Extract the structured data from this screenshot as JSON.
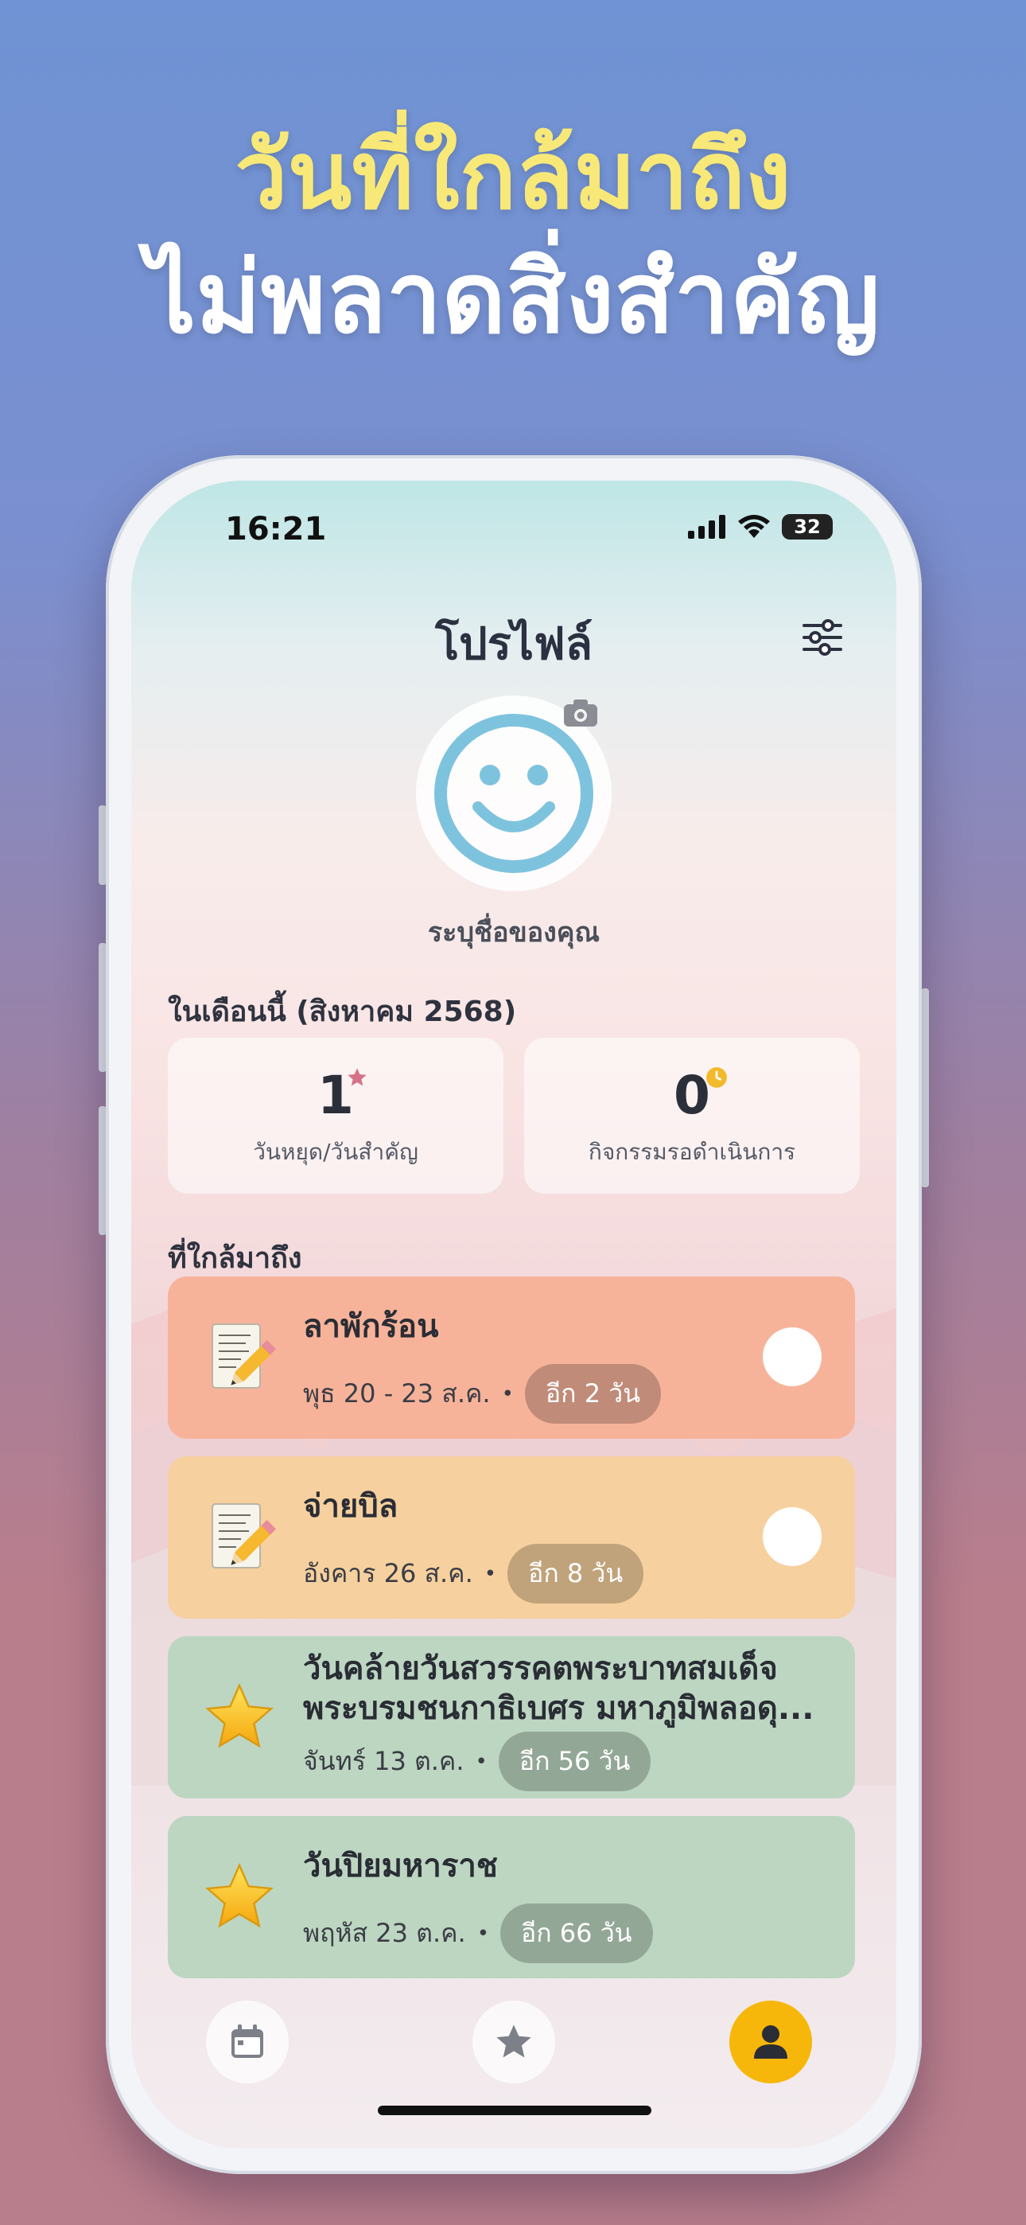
{
  "headline": {
    "line1": "วันที่ใกล้มาถึง",
    "line2": "ไม่พลาดสิ่งสำคัญ"
  },
  "status_bar": {
    "time": "16:21",
    "battery": "32"
  },
  "header": {
    "title": "โปรไฟล์"
  },
  "profile": {
    "name_placeholder": "ระบุชื่อของคุณ"
  },
  "month_summary": {
    "label": "ในเดือนนี้ (สิงหาคม 2568)",
    "holidays": {
      "count": "1",
      "label": "วันหยุด/วันสำคัญ"
    },
    "pending": {
      "count": "0",
      "label": "กิจกรรมรอดำเนินการ"
    }
  },
  "upcoming": {
    "label": "ที่ใกล้มาถึง",
    "items": [
      {
        "name": "ลาพักร้อน",
        "date": "พุธ 20 - 23 ส.ค.",
        "dot": "•",
        "countdown": "อีก 2 วัน",
        "color": "#f7b39a",
        "icon": "memo-icon",
        "checkbox": true
      },
      {
        "name": "จ่ายบิล",
        "date": "อังคาร 26 ส.ค.",
        "dot": "•",
        "countdown": "อีก 8 วัน",
        "color": "#f6d09e",
        "icon": "memo-icon",
        "checkbox": true
      },
      {
        "name": "วันคล้ายวันสวรรคตพระบาทสมเด็จพระบรมชนกาธิเบศร มหาภูมิพลอดุ...",
        "date": "จันทร์ 13 ต.ค.",
        "dot": "•",
        "countdown": "อีก 56 วัน",
        "color": "#bdd6c2",
        "icon": "star-icon",
        "checkbox": false
      },
      {
        "name": "วันปิยมหาราช",
        "date": "พฤหัส 23 ต.ค.",
        "dot": "•",
        "countdown": "อีก 66 วัน",
        "color": "#bdd6c2",
        "icon": "star-icon",
        "checkbox": false
      }
    ]
  },
  "tabbar": {
    "active_color": "#f6b70a",
    "tabs": [
      "calendar-icon",
      "star-icon",
      "person-icon"
    ]
  }
}
